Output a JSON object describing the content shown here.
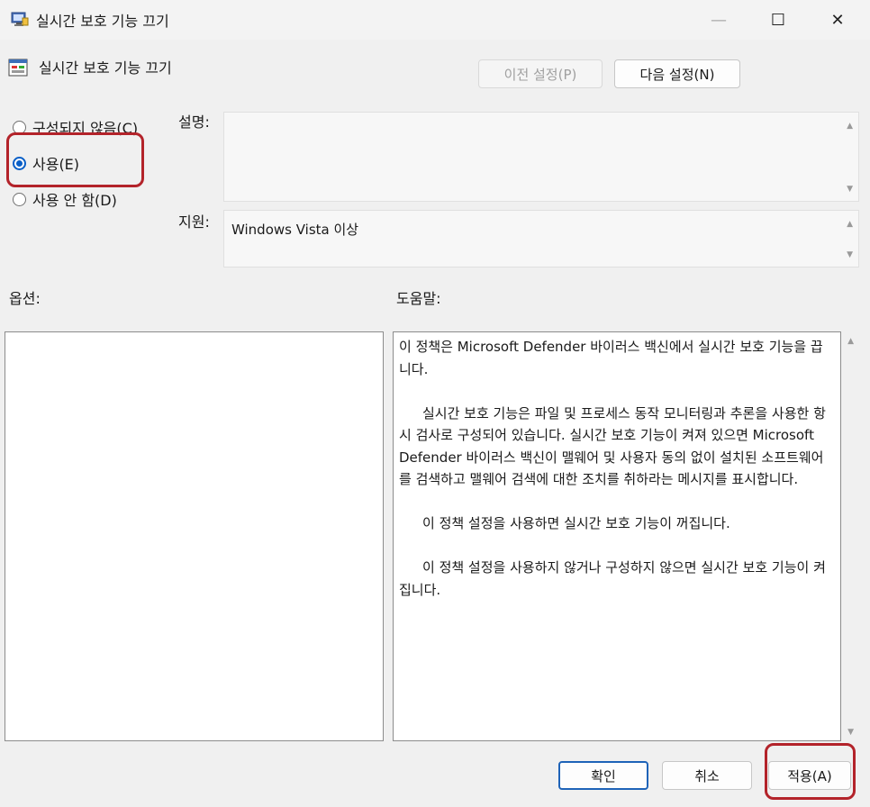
{
  "window": {
    "title": "실시간 보호 기능 끄기",
    "controls": {
      "minimize": "—",
      "maximize": "☐",
      "close": "✕"
    }
  },
  "policy": {
    "title": "실시간 보호 기능 끄기"
  },
  "nav": {
    "prev_label": "이전 설정(P)",
    "next_label": "다음 설정(N)"
  },
  "radios": [
    {
      "label": "구성되지 않음(C)",
      "checked": false
    },
    {
      "label": "사용(E)",
      "checked": true
    },
    {
      "label": "사용 안 함(D)",
      "checked": false
    }
  ],
  "fields": {
    "description_label": "설명:",
    "description_value": "",
    "supported_label": "지원:",
    "supported_value": "Windows Vista 이상"
  },
  "sections": {
    "options_label": "옵션:",
    "help_label": "도움말:"
  },
  "help": {
    "paragraphs": [
      "이 정책은 Microsoft Defender 바이러스 백신에서 실시간 보호 기능을 끕니다.",
      "실시간 보호 기능은 파일 및 프로세스 동작 모니터링과 추론을 사용한 항시 검사로 구성되어 있습니다. 실시간 보호 기능이 켜져 있으면 Microsoft Defender 바이러스 백신이 맬웨어 및 사용자 동의 없이 설치된 소프트웨어를 검색하고 맬웨어 검색에 대한 조치를 취하라는 메시지를 표시합니다.",
      "이 정책 설정을 사용하면 실시간 보호 기능이 꺼집니다.",
      "이 정책 설정을 사용하지 않거나 구성하지 않으면 실시간 보호 기능이 켜집니다."
    ]
  },
  "buttons": {
    "ok": "확인",
    "cancel": "취소",
    "apply": "적용(A)"
  },
  "colors": {
    "highlight": "#b3232a",
    "accent": "#0a5fc7"
  }
}
